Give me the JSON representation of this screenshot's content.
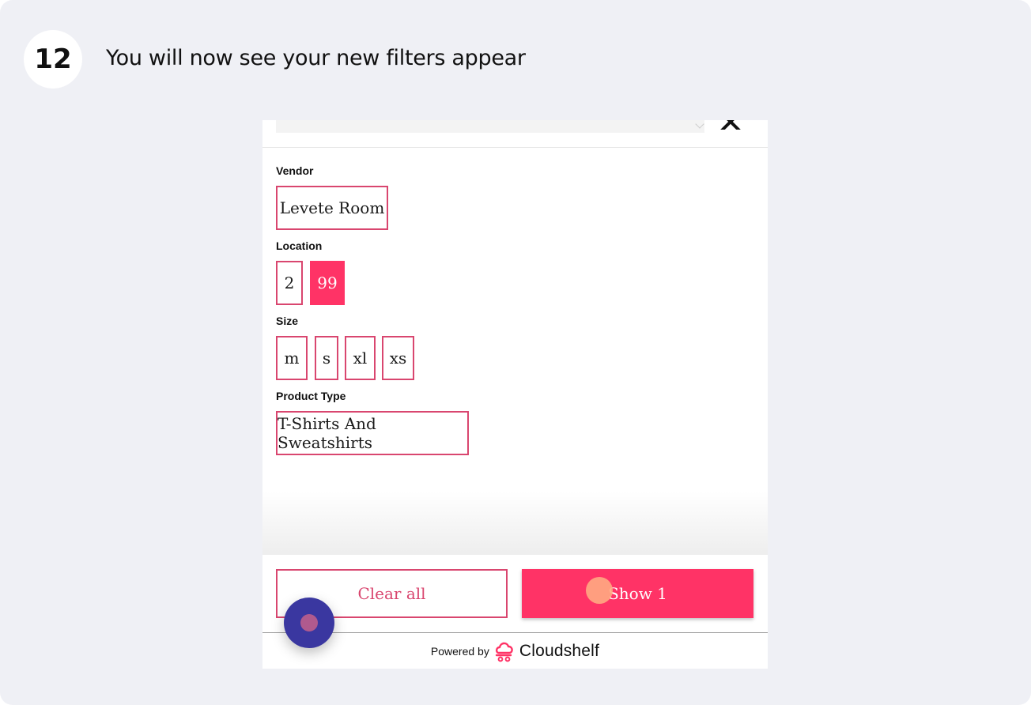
{
  "step": {
    "number": "12",
    "title": "You will now see your new filters appear"
  },
  "filters": {
    "vendor": {
      "label": "Vendor",
      "options": [
        "Levete Room"
      ]
    },
    "location": {
      "label": "Location",
      "options": [
        "2",
        "99"
      ],
      "selected": "99"
    },
    "size": {
      "label": "Size",
      "options": [
        "m",
        "s",
        "xl",
        "xs"
      ]
    },
    "product_type": {
      "label": "Product Type",
      "options": [
        "T-Shirts And Sweatshirts"
      ]
    }
  },
  "actions": {
    "clear_label": "Clear all",
    "show_label": "Show 1"
  },
  "branding": {
    "powered_by": "Powered by",
    "brand": "Cloudshelf"
  },
  "colors": {
    "accent": "#ff3366",
    "chip_border": "#d9466f",
    "background": "#eff0f5",
    "chat_bubble": "#3a37a0"
  },
  "icons": [
    "close-icon",
    "cloudshelf-logo-icon",
    "chat-icon"
  ]
}
